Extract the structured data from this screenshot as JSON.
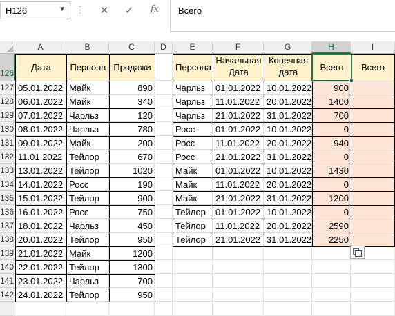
{
  "formula_bar": {
    "name_box": "H126",
    "cancel_icon": "✕",
    "enter_icon": "✓",
    "fx_icon": "fx",
    "formula": "Всего"
  },
  "columns": [
    "A",
    "B",
    "C",
    "D",
    "E",
    "F",
    "G",
    "H",
    "I"
  ],
  "rows": [
    "126",
    "127",
    "128",
    "129",
    "130",
    "131",
    "132",
    "133",
    "134",
    "135",
    "136",
    "137",
    "138",
    "139",
    "140",
    "141",
    "142"
  ],
  "left_table": {
    "headers": [
      "Дата",
      "Персона",
      "Продажи"
    ],
    "rows": [
      [
        "05.01.2022",
        "Майк",
        "890"
      ],
      [
        "06.01.2022",
        "Майк",
        "340"
      ],
      [
        "07.01.2022",
        "Чарльз",
        "120"
      ],
      [
        "08.01.2022",
        "Чарльз",
        "780"
      ],
      [
        "09.01.2022",
        "Майк",
        "200"
      ],
      [
        "11.01.2022",
        "Тейлор",
        "670"
      ],
      [
        "13.01.2022",
        "Тейлор",
        "1020"
      ],
      [
        "14.01.2022",
        "Росс",
        "190"
      ],
      [
        "15.01.2022",
        "Тейлор",
        "900"
      ],
      [
        "16.01.2022",
        "Росс",
        "750"
      ],
      [
        "18.01.2022",
        "Чарльз",
        "450"
      ],
      [
        "20.01.2022",
        "Тейлор",
        "950"
      ],
      [
        "21.01.2022",
        "Майк",
        "1200"
      ],
      [
        "22.01.2022",
        "Тейлор",
        "1300"
      ],
      [
        "23.01.2022",
        "Чарльз",
        "700"
      ],
      [
        "24.01.2022",
        "Тейлор",
        "950"
      ]
    ]
  },
  "right_table": {
    "headers": [
      "Персона",
      "Начальная Дата",
      "Конечная дата",
      "Всего",
      "Всего"
    ],
    "rows": [
      [
        "Чарльз",
        "01.01.2022",
        "10.01.2022",
        "900",
        ""
      ],
      [
        "Чарльз",
        "11.01.2022",
        "20.01.2022",
        "1400",
        ""
      ],
      [
        "Чарльз",
        "21.01.2022",
        "31.01.2022",
        "700",
        ""
      ],
      [
        "Росс",
        "01.01.2022",
        "10.01.2022",
        "0",
        ""
      ],
      [
        "Росс",
        "11.01.2022",
        "20.01.2022",
        "940",
        ""
      ],
      [
        "Росс",
        "21.01.2022",
        "31.01.2022",
        "0",
        ""
      ],
      [
        "Майк",
        "01.01.2022",
        "10.01.2022",
        "1430",
        ""
      ],
      [
        "Майк",
        "11.01.2022",
        "20.01.2022",
        "0",
        ""
      ],
      [
        "Майк",
        "21.01.2022",
        "31.01.2022",
        "1200",
        ""
      ],
      [
        "Тейлор",
        "01.01.2022",
        "10.01.2022",
        "0",
        ""
      ],
      [
        "Тейлор",
        "11.01.2022",
        "20.01.2022",
        "2590",
        ""
      ],
      [
        "Тейлор",
        "21.01.2022",
        "31.01.2022",
        "2250",
        ""
      ]
    ]
  },
  "colors": {
    "header_fill": "#fff2cc",
    "total_fill": "#fce4d6",
    "selection": "#217346"
  }
}
